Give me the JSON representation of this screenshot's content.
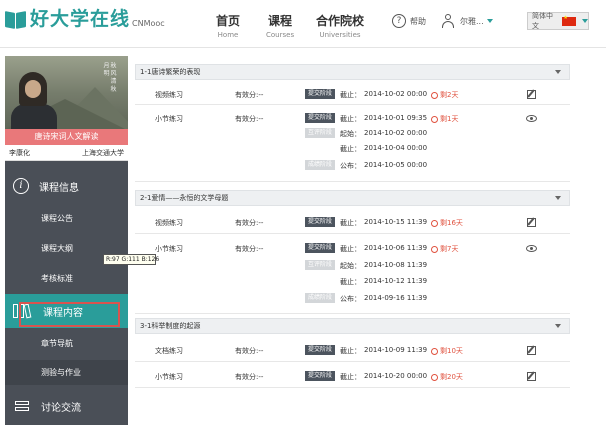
{
  "header": {
    "logo_cn": "好大学在线",
    "logo_en": "CNMooc",
    "nav": [
      {
        "cn": "首页",
        "en": "Home"
      },
      {
        "cn": "课程",
        "en": "Courses"
      },
      {
        "cn": "合作院校",
        "en": "Universities"
      }
    ],
    "help_label": "帮助",
    "help_glyph": "?",
    "user_name": "尔雅...",
    "lang_label": "简体中文"
  },
  "sidebar": {
    "course_title": "唐诗宋词人文解读",
    "teacher": "李康化",
    "university": "上海交通大学",
    "calligraphy": "秋 风 清 秋 月 明",
    "info_glyph": "i",
    "sections": [
      {
        "label": "课程信息",
        "items": [
          "课程公告",
          "课程大纲",
          "考核标准"
        ]
      },
      {
        "label": "课程内容",
        "items": [
          "章节导航",
          "测验与作业"
        ]
      },
      {
        "label": "讨论交流",
        "items": []
      }
    ],
    "tooltip": "R:97 G:111 B:126"
  },
  "labels": {
    "validity": "有效分:--",
    "submit": "提交阶段",
    "review": "互评阶段",
    "grade": "成绩阶段",
    "deadline": "截止：",
    "start": "起始：",
    "publish": "公布："
  },
  "chapters": [
    {
      "title": "1-1唐诗繁荣的表现",
      "rows": [
        {
          "name": "视频练习",
          "deadline": "2014-10-02 00:00",
          "remain": "剩2天",
          "icon": "edit"
        },
        {
          "name": "小节练习",
          "deadline": "2014-10-01 09:35",
          "remain": "剩1天",
          "icon": "eye",
          "review_start": "2014-10-02 00:00",
          "review_end": "2014-10-04 00:00",
          "publish": "2014-10-05 00:00"
        }
      ]
    },
    {
      "title": "2-1爱情——永恒的文学母题",
      "rows": [
        {
          "name": "视频练习",
          "deadline": "2014-10-15 11:39",
          "remain": "剩16天",
          "icon": "edit"
        },
        {
          "name": "小节练习",
          "deadline": "2014-10-06 11:39",
          "remain": "剩7天",
          "icon": "eye",
          "review_start": "2014-10-08 11:39",
          "review_end": "2014-10-12 11:39",
          "publish": "2014-09-16 11:39"
        }
      ]
    },
    {
      "title": "3-1科举制度的起源",
      "rows": [
        {
          "name": "文档练习",
          "deadline": "2014-10-09 11:39",
          "remain": "剩10天",
          "icon": "edit"
        },
        {
          "name": "小节练习",
          "deadline": "2014-10-20 00:00",
          "remain": "剩20天",
          "icon": "edit"
        }
      ]
    }
  ]
}
